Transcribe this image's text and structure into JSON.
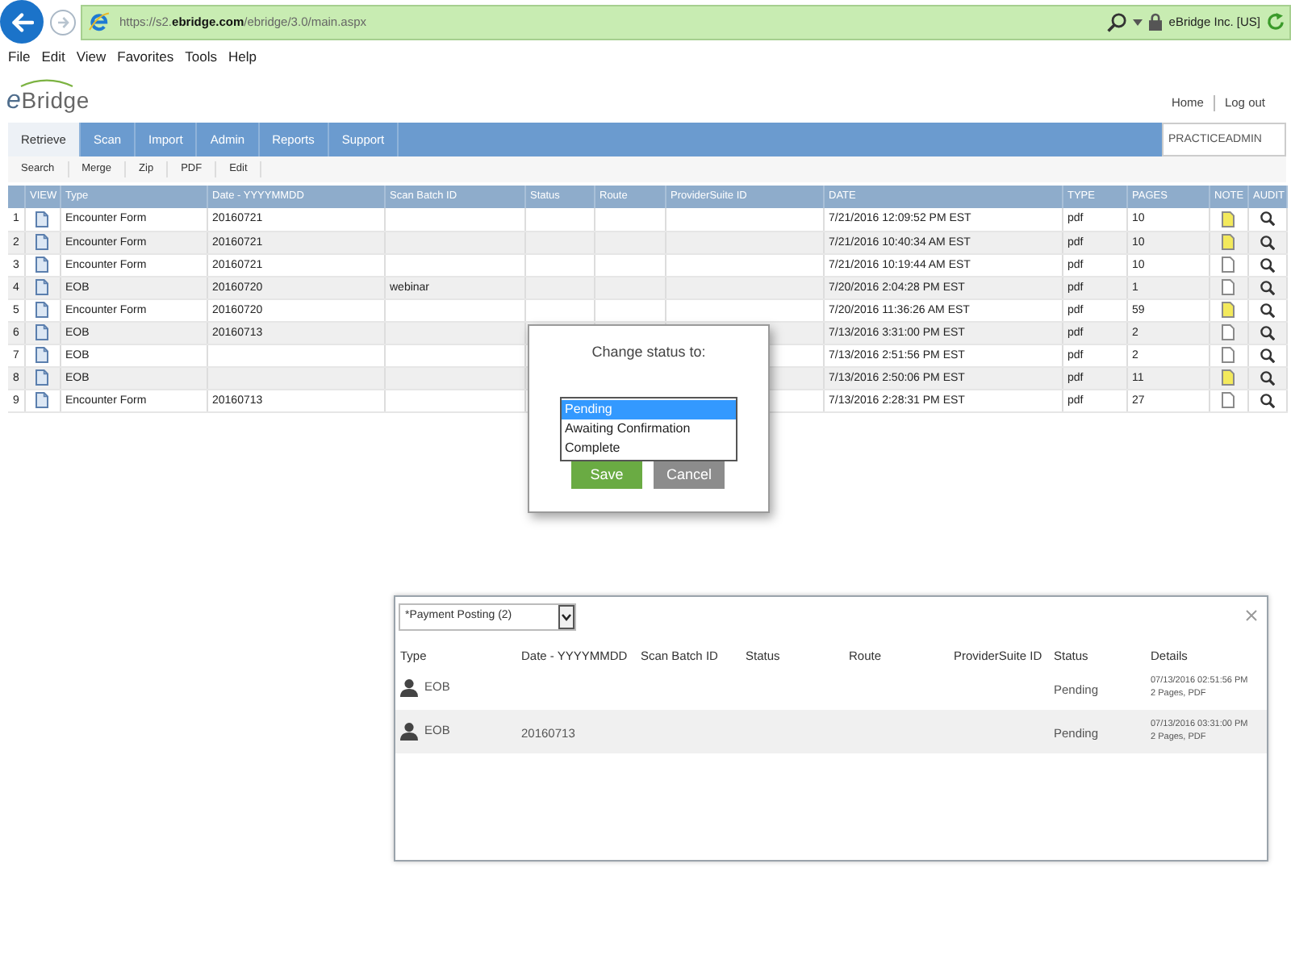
{
  "browser": {
    "url": "https://s2.**ebridge.com**/ebridge/3.0/main.aspx",
    "site_identity": "eBridge Inc. [US]"
  },
  "menu": [
    "File",
    "Edit",
    "View",
    "Favorites",
    "Tools",
    "Help"
  ],
  "header": {
    "logo": "eBridge",
    "links": [
      "Home",
      "Log out"
    ]
  },
  "tabs": [
    {
      "label": "Retrieve",
      "selected": true
    },
    {
      "label": "Scan",
      "selected": false
    },
    {
      "label": "Import",
      "selected": false
    },
    {
      "label": "Admin",
      "selected": false
    },
    {
      "label": "Reports",
      "selected": false
    },
    {
      "label": "Support",
      "selected": false
    }
  ],
  "user": "PRACTICEADMIN",
  "toolbar": [
    "Search",
    "Merge",
    "Zip",
    "PDF",
    "Edit"
  ],
  "table": {
    "columns": [
      "VIEW",
      "Type",
      "Date - YYYYMMDD",
      "Scan Batch ID",
      "Status",
      "Route",
      "ProviderSuite ID",
      "DATE",
      "TYPE",
      "PAGES",
      "NOTE",
      "AUDIT"
    ],
    "rows": [
      {
        "number": "1",
        "type": "Encounter Form",
        "date": "20160721",
        "timestamp": "7/21/2016 12:09:52 PM EST",
        "file_type": "pdf",
        "pages": "10",
        "has_note": true
      },
      {
        "number": "2",
        "type": "Encounter Form",
        "date": "20160721",
        "timestamp": "7/21/2016 10:40:34 AM EST",
        "file_type": "pdf",
        "pages": "10",
        "has_note": true
      },
      {
        "number": "3",
        "type": "Encounter Form",
        "date": "20160721",
        "timestamp": "7/21/2016 10:19:44 AM EST",
        "file_type": "pdf",
        "pages": "10",
        "has_note": false
      },
      {
        "number": "4",
        "type": "EOB",
        "date": "20160720",
        "scan_batch_id": "webinar",
        "timestamp": "7/20/2016 2:04:28 PM EST",
        "file_type": "pdf",
        "pages": "1",
        "has_note": false
      },
      {
        "number": "5",
        "type": "Encounter Form",
        "date": "20160720",
        "timestamp": "7/20/2016 11:36:26 AM EST",
        "file_type": "pdf",
        "pages": "59",
        "has_note": true
      },
      {
        "number": "6",
        "type": "EOB",
        "date": "20160713",
        "timestamp": "7/13/2016 3:31:00 PM EST",
        "file_type": "pdf",
        "pages": "2",
        "has_note": false
      },
      {
        "number": "7",
        "type": "EOB",
        "timestamp": "7/13/2016 2:51:56 PM EST",
        "file_type": "pdf",
        "pages": "2",
        "has_note": false
      },
      {
        "number": "8",
        "type": "EOB",
        "timestamp": "7/13/2016 2:50:06 PM EST",
        "file_type": "pdf",
        "pages": "11",
        "has_note": true
      },
      {
        "number": "9",
        "type": "Encounter Form",
        "date": "20160713",
        "timestamp": "7/13/2016 2:28:31 PM EST",
        "file_type": "pdf",
        "pages": "27",
        "has_note": false
      }
    ]
  },
  "dialog": {
    "title": "Change status to:",
    "options": [
      {
        "label": "Pending",
        "selected": true
      },
      {
        "label": "Awaiting Confirmation",
        "selected": false
      },
      {
        "label": "Complete",
        "selected": false
      }
    ],
    "buttons": [
      {
        "kind": "save",
        "label": "Save"
      },
      {
        "kind": "cancel",
        "label": "Cancel"
      }
    ]
  },
  "panel": {
    "filter": "*Payment Posting (2)",
    "columns": [
      "Type",
      "Date - YYYYMMDD",
      "Scan Batch ID",
      "Status",
      "Route",
      "ProviderSuite ID",
      "Status",
      "Details"
    ],
    "rows": [
      {
        "type": "EOB",
        "status": "Pending",
        "details": {
          "time": "07/13/2016 02:51:56 PM",
          "info": "2 Pages, PDF"
        }
      },
      {
        "type": "EOB",
        "date": "20160713",
        "status": "Pending",
        "details": {
          "time": "07/13/2016 03:31:00 PM",
          "info": "2 Pages, PDF"
        }
      }
    ]
  }
}
